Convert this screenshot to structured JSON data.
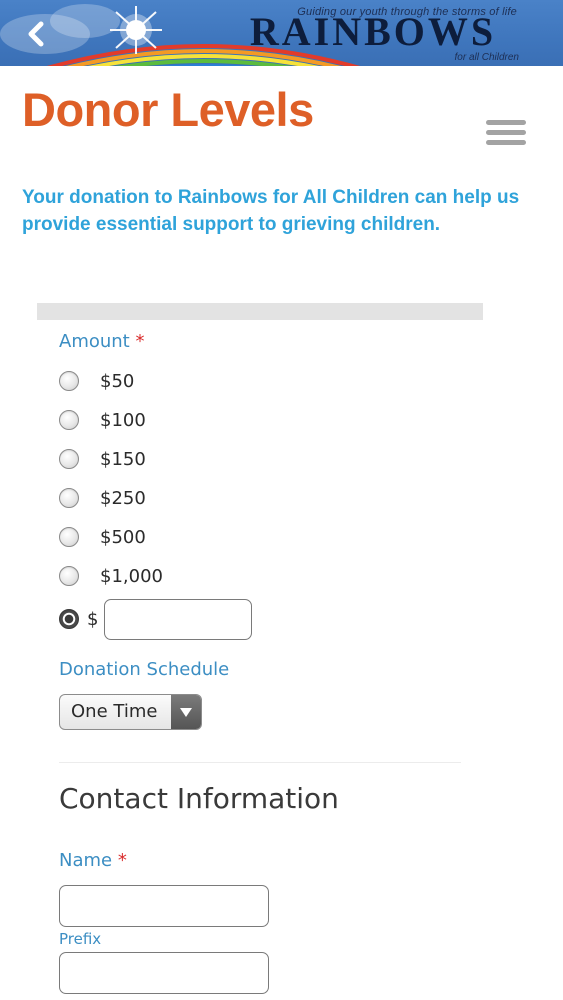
{
  "header": {
    "tagline": "Guiding our youth through the storms of life",
    "brand": "RAINBOWS",
    "brand_sub": "for all Children",
    "back_icon": "chevron-left-icon",
    "colors": {
      "banner": "#4a82c8",
      "brand_text": "#0d1d3c"
    }
  },
  "page": {
    "title": "Donor Levels",
    "menu_icon": "hamburger-menu-icon",
    "intro": "Your donation to Rainbows for All Children can help us provide essential support to grieving children.",
    "colors": {
      "title": "#de5f27",
      "intro": "#2fa3da",
      "label": "#3c8ec3",
      "required": "#d92c2c"
    }
  },
  "form": {
    "amount": {
      "label": "Amount",
      "required_mark": "*",
      "options": [
        "$50",
        "$100",
        "$150",
        "$250",
        "$500",
        "$1,000"
      ],
      "custom_prefix": "$",
      "custom_value": "",
      "selected": "custom"
    },
    "schedule": {
      "label": "Donation Schedule",
      "selected": "One Time"
    },
    "contact": {
      "section_title": "Contact Information",
      "name_label": "Name",
      "required_mark": "*",
      "prefix_label": "Prefix",
      "prefix_value": "",
      "first_value": ""
    }
  }
}
